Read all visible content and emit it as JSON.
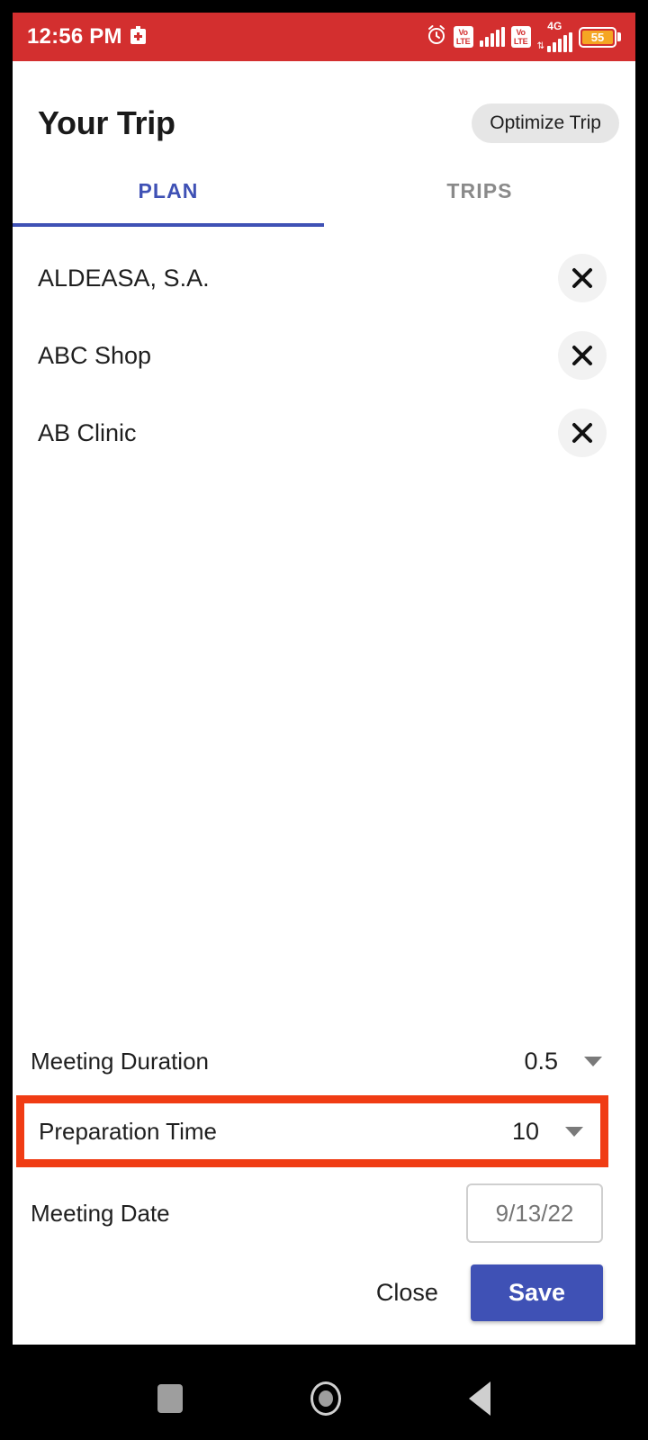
{
  "status_bar": {
    "time": "12:56 PM",
    "icons": {
      "medical_kit": "medical-kit-icon",
      "alarm": "alarm-clock-icon",
      "volte_1": "VoLTE",
      "volte_2": "VoLTE",
      "network_label": "4G",
      "data_arrows": "⇅"
    },
    "battery_percent": "55",
    "background_color": "#d32f2f",
    "battery_fill_color": "#f5a623"
  },
  "header": {
    "title": "Your Trip",
    "optimize_label": "Optimize Trip"
  },
  "tabs": {
    "items": [
      {
        "label": "PLAN",
        "active": true
      },
      {
        "label": "TRIPS",
        "active": false
      }
    ],
    "active_color": "#3f51b5",
    "inactive_color": "#8a8a8a"
  },
  "locations": {
    "items": [
      {
        "name": "ALDEASA, S.A.",
        "remove_icon": "close-icon"
      },
      {
        "name": "ABC Shop",
        "remove_icon": "close-icon"
      },
      {
        "name": "AB Clinic",
        "remove_icon": "close-icon"
      }
    ]
  },
  "form": {
    "meeting_duration": {
      "label": "Meeting Duration",
      "value": "0.5",
      "caret_icon": "chevron-down-icon"
    },
    "preparation_time": {
      "label": "Preparation Time",
      "value": "10",
      "caret_icon": "chevron-down-icon",
      "highlighted": true,
      "highlight_color": "#f03c14"
    },
    "meeting_date": {
      "label": "Meeting Date",
      "value": "9/13/22",
      "placeholder": "9/13/22"
    }
  },
  "actions": {
    "close_label": "Close",
    "save_label": "Save",
    "save_color": "#3f51b5"
  },
  "navigation_bar": {
    "recents": "square-recents-icon",
    "home": "circle-home-icon",
    "back": "triangle-back-icon"
  }
}
